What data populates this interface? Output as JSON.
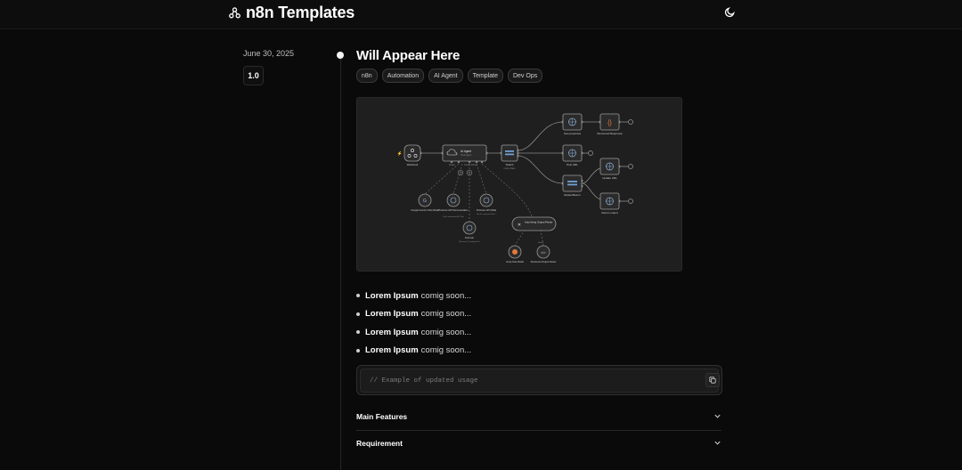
{
  "header": {
    "title": "n8n Templates",
    "logo_icon": "nodes-icon",
    "theme_icon": "moon-icon"
  },
  "release": {
    "date": "June 30, 2025",
    "version": "1.0",
    "title": "Will Appear Here",
    "tags": [
      "n8n",
      "Automation",
      "AI Agent",
      "Template",
      "Dev Ops"
    ],
    "workflow": {
      "nodes": {
        "webhook": "Webhook",
        "ai_agent": "AI Agent",
        "ai_agent_sub": "Tools Agent",
        "switch": "Switch",
        "switch_sub": "mode: Rules",
        "get_properties": "Get properties",
        "structured_response": "Structured Response",
        "post_url": "Post URL",
        "delete_return": "Delete/Return",
        "update_url": "Update URL",
        "return_output": "Return output",
        "google_gemini": "Google Gemini Chat Model",
        "postman_docs": "Postman API Documentation",
        "postman_docs_sub": "Tool: Information API Tool",
        "postman_api": "Postman API (Wiki)",
        "postman_api_sub": "Get the requested info...",
        "postman": "Postman",
        "postman_sub": "Memory @ Loading Post",
        "auto_fixing": "Auto-fixing Output Parser",
        "groq": "Groq Chat Model",
        "structured_parser": "Structured Output Parser",
        "model_label": "Model",
        "output_parser_label": "Output Parser"
      }
    },
    "bullets": [
      {
        "bold": "Lorem Ipsum",
        "text": "comig soon..."
      },
      {
        "bold": "Lorem Ipsum",
        "text": "comig soon..."
      },
      {
        "bold": "Lorem Ipsum",
        "text": "comig soon..."
      },
      {
        "bold": "Lorem Ipsum",
        "text": "comig soon..."
      }
    ],
    "code": "// Example of updated usage",
    "copy_icon": "copy-icon",
    "accordions": [
      {
        "label": "Main Features",
        "icon": "chevron-down-icon"
      },
      {
        "label": "Requirement",
        "icon": "chevron-down-icon"
      }
    ]
  },
  "colors": {
    "background": "#0a0a0a",
    "canvas": "#1f1f1f",
    "accent_orange": "#e07a3a"
  }
}
